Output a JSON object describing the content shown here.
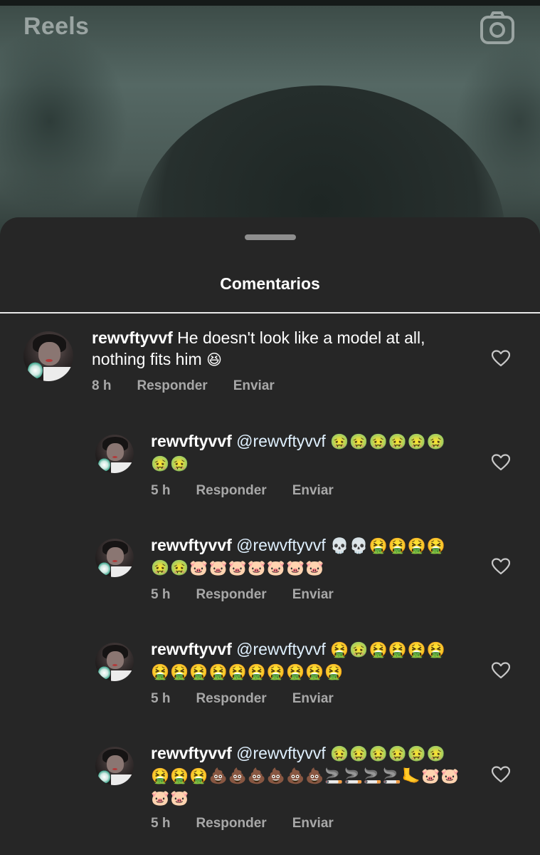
{
  "header": {
    "title": "Reels",
    "camera_icon": "camera-icon"
  },
  "sheet": {
    "title": "Comentarios"
  },
  "comments": [
    {
      "username": "rewvftyvvf",
      "text": " He doesn't look like a model at all, nothing fits him ",
      "emoji": "😆",
      "time": "8 h",
      "reply_label": "Responder",
      "send_label": "Enviar"
    }
  ],
  "replies": [
    {
      "username": "rewvftyvvf",
      "mention": "@rewvftyvvf",
      "emoji": "🤢🤢🤢🤢🤢🤢🤢🤢",
      "time": "5 h",
      "reply_label": "Responder",
      "send_label": "Enviar"
    },
    {
      "username": "rewvftyvvf",
      "mention": "@rewvftyvvf",
      "emoji": "💀💀🤮🤮🤮🤮🤢🤢🐷🐷🐷🐷🐷🐷🐷",
      "time": "5 h",
      "reply_label": "Responder",
      "send_label": "Enviar"
    },
    {
      "username": "rewvftyvvf",
      "mention": "@rewvftyvvf",
      "emoji": "🤮🤢🤮🤮🤮🤮🤮🤮🤮🤮🤮🤮🤮🤮🤮🤮",
      "time": "5 h",
      "reply_label": "Responder",
      "send_label": "Enviar"
    },
    {
      "username": "rewvftyvvf",
      "mention": "@rewvftyvvf",
      "emoji": "🤢🤢🤢🤢🤢🤢🤮🤮🤮💩💩💩💩💩💩🚬🚬🚬🚬🦶🐷🐷🐷🐷",
      "time": "5 h",
      "reply_label": "Responder",
      "send_label": "Enviar"
    }
  ]
}
